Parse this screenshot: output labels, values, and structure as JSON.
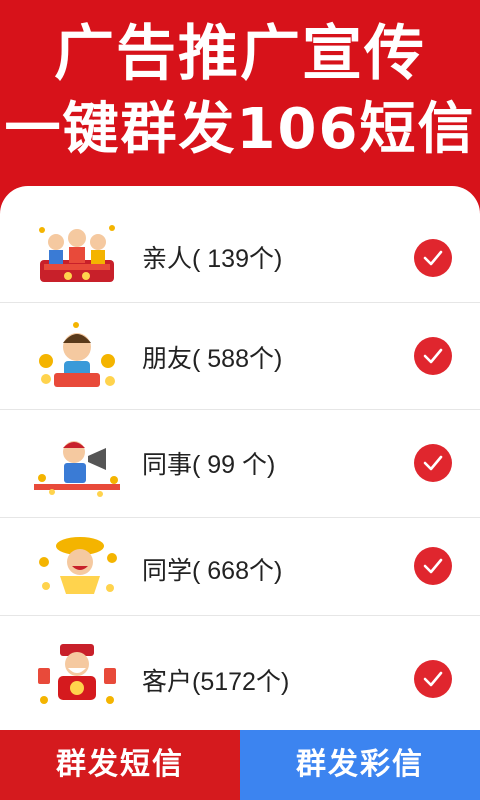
{
  "header": {
    "line1": "广告推广宣传",
    "line2": "一键群发106短信"
  },
  "groups": [
    {
      "label": "亲人( 139个)",
      "illustration": "family-icon",
      "checked": true
    },
    {
      "label": "朋友( 588个)",
      "illustration": "friend-icon",
      "checked": true
    },
    {
      "label": "同事(  99 个)",
      "illustration": "colleague-icon",
      "checked": true
    },
    {
      "label": "同学( 668个)",
      "illustration": "classmate-icon",
      "checked": true
    },
    {
      "label": "客户(5172个)",
      "illustration": "customer-icon",
      "checked": true
    }
  ],
  "buttons": {
    "sms": "群发短信",
    "mms": "群发彩信"
  },
  "colors": {
    "primary_red": "#d7121a",
    "check_red": "#e0262e",
    "mms_blue": "#3c84f0"
  }
}
